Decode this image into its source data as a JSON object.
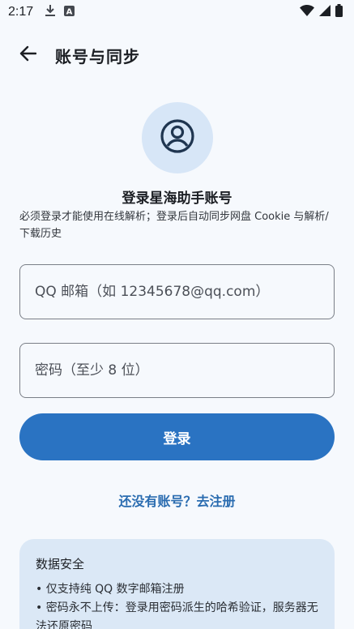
{
  "status_bar": {
    "time": "2:17",
    "icons": [
      "download-icon",
      "a-badge-icon",
      "wifi-icon",
      "signal-icon",
      "battery-icon"
    ]
  },
  "app_bar": {
    "title": "账号与同步",
    "back_icon": "arrow-left-icon"
  },
  "header": {
    "avatar_icon": "account-circle-icon",
    "title": "登录星海助手账号",
    "subtitle": "必须登录才能使用在线解析；登录后自动同步网盘 Cookie 与解析/下载历史"
  },
  "form": {
    "email_placeholder": "QQ 邮箱（如 12345678@qq.com）",
    "email_value": "",
    "password_placeholder": "密码（至少 8 位）",
    "password_value": "",
    "login_label": "登录",
    "register_link": "还没有账号？去注册"
  },
  "security": {
    "title": "数据安全",
    "items": [
      "• 仅支持纯 QQ 数字邮箱注册",
      "• 密码永不上传：登录用密码派生的哈希验证，服务器无法还原密码"
    ]
  },
  "colors": {
    "primary": "#2a73c2",
    "link": "#2a6cb0",
    "avatar_bg": "#d7e6f7",
    "card_bg": "#dbe8f6",
    "page_bg": "#f6f9fd"
  }
}
